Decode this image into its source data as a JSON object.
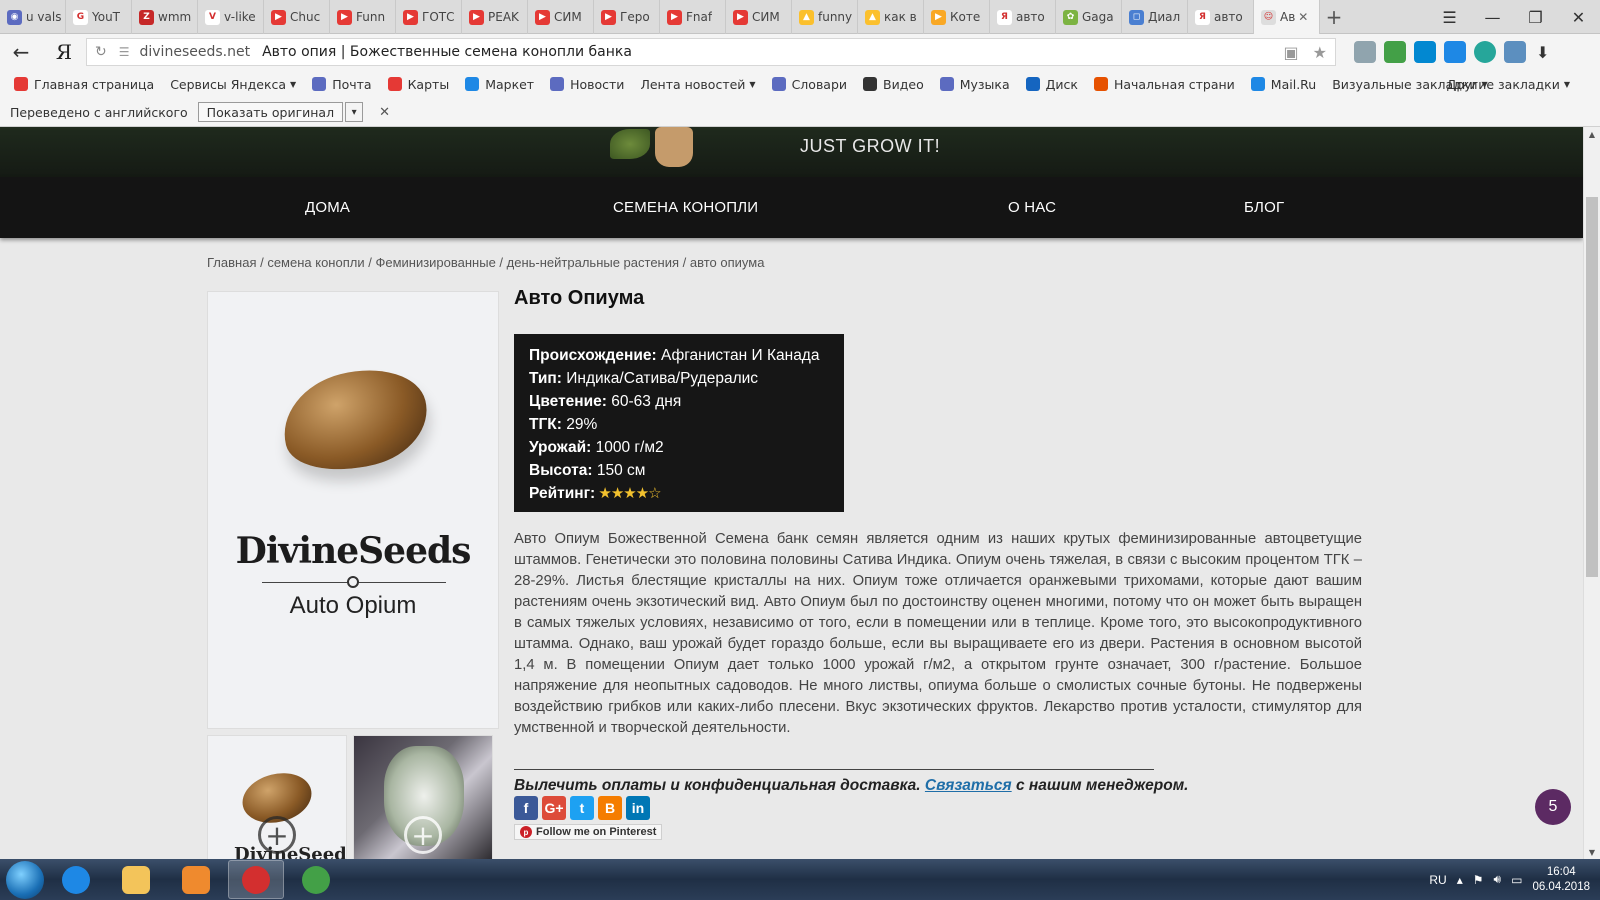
{
  "browser": {
    "tabs": [
      {
        "label": "u vals",
        "color": "#5c6bc0",
        "glyph": "◉"
      },
      {
        "label": "YouT",
        "color": "#ffffff",
        "glyph": "G"
      },
      {
        "label": "wmm",
        "color": "#c62828",
        "glyph": "Z"
      },
      {
        "label": "v-like",
        "color": "#ffffff",
        "glyph": "V"
      },
      {
        "label": "Chuc",
        "color": "#e53935",
        "glyph": "▶"
      },
      {
        "label": "Funn",
        "color": "#e53935",
        "glyph": "▶"
      },
      {
        "label": "ГОТС",
        "color": "#e53935",
        "glyph": "▶"
      },
      {
        "label": "PEAK",
        "color": "#e53935",
        "glyph": "▶"
      },
      {
        "label": "СИМ",
        "color": "#e53935",
        "glyph": "▶"
      },
      {
        "label": "Геро",
        "color": "#e53935",
        "glyph": "▶"
      },
      {
        "label": "Fnaf",
        "color": "#e53935",
        "glyph": "▶"
      },
      {
        "label": "СИМ",
        "color": "#e53935",
        "glyph": "▶"
      },
      {
        "label": "funny",
        "color": "#fbc02d",
        "glyph": "▲"
      },
      {
        "label": "как в",
        "color": "#fbc02d",
        "glyph": "▲"
      },
      {
        "label": "Коте",
        "color": "#f9a825",
        "glyph": "▶"
      },
      {
        "label": "авто",
        "color": "#ffffff",
        "glyph": "Я"
      },
      {
        "label": "Gaga",
        "color": "#7cb342",
        "glyph": "✿"
      },
      {
        "label": "Диал",
        "color": "#4a7fd1",
        "glyph": "◻"
      },
      {
        "label": "авто",
        "color": "#ffffff",
        "glyph": "Я"
      },
      {
        "label": "Ав",
        "color": "#dddddd",
        "glyph": "☺",
        "active": true
      }
    ],
    "new_tab": "+",
    "menu_icon": "☰",
    "minimize": "—",
    "restore": "❐",
    "close": "✕",
    "back": "←",
    "yandex_logo": "Я",
    "reload": "↻",
    "url_domain": "divineseeds.net",
    "url_title": "Авто опия | Божественные семена конопли банка",
    "download_icon": "⬇",
    "bookmarks": [
      {
        "label": "Главная страница",
        "color": "#e53935"
      },
      {
        "label": "Сервисы Яндекса",
        "color": "",
        "caret": true
      },
      {
        "label": "Почта",
        "color": "#5c6bc0"
      },
      {
        "label": "Карты",
        "color": "#e53935"
      },
      {
        "label": "Маркет",
        "color": "#1e88e5"
      },
      {
        "label": "Новости",
        "color": "#5c6bc0"
      },
      {
        "label": "Лента новостей",
        "color": "",
        "caret": true
      },
      {
        "label": "Словари",
        "color": "#5c6bc0"
      },
      {
        "label": "Видео",
        "color": "#333333"
      },
      {
        "label": "Музыка",
        "color": "#5c6bc0"
      },
      {
        "label": "Диск",
        "color": "#1565c0"
      },
      {
        "label": "Начальная страни",
        "color": "#e65100"
      },
      {
        "label": "Mail.Ru",
        "color": "#1e88e5"
      },
      {
        "label": "Визуальные закладки",
        "color": "",
        "caret": true
      }
    ],
    "other_bookmarks": "Другие закладки",
    "translated_from": "Переведено с английского",
    "show_original": "Показать оригинал",
    "close_icon": "✕",
    "caret": "▾"
  },
  "site": {
    "tagline": "JUST GROW IT!",
    "nav": [
      "ДОМА",
      "СЕМЕНА КОНОПЛИ",
      "О НАС",
      "БЛОГ"
    ],
    "breadcrumb": [
      "Главная",
      "семена конопли",
      "Феминизированные",
      "день-нейтральные растения",
      "авто опиума"
    ],
    "image_logo": "DivineSeeds",
    "image_sub": "Auto Opium",
    "plus": "+",
    "product_title": "Авто Опиума",
    "specs": [
      {
        "label": "Происхождение:",
        "value": "Афганистан И Канада"
      },
      {
        "label": "Тип:",
        "value": "Индика/Сатива/Рудералис"
      },
      {
        "label": "Цветение:",
        "value": "60-63 дня"
      },
      {
        "label": "ТГК:",
        "value": "29%"
      },
      {
        "label": "Урожай:",
        "value": "1000 г/м2"
      },
      {
        "label": "Высота:",
        "value": "150 см"
      }
    ],
    "rating_label": "Рейтинг:",
    "rating_stars": 4,
    "rating_max": 5,
    "description": "Авто Опиум Божественной Семена банк семян является одним из наших крутых феминизированные автоцветущие штаммов. Генетически это половина половины Сатива Индика. Опиум очень тяжелая, в связи с высоким процентом ТГК – 28-29%. Листья блестящие кристаллы на них. Опиум тоже отличается оранжевыми трихомами, которые дают вашим растениям очень экзотический вид. Авто Опиум был по достоинству оценен многими, потому что он может быть выращен в самых тяжелых условиях, независимо от того, если в помещении или в теплице. Кроме того, это высокопродуктивного штамма. Однако, ваш урожай будет гораздо больше, если вы выращиваете его из двери. Растения в основном высотой 1,4 м. В помещении Опиум дает только 1000 урожай г/м2, а открытом грунте означает, 300 г/растение. Большое напряжение для неопытных садоводов. Не много листвы, опиума больше о смолистых сочные бутоны. Не подвержены воздействию грибков или каких-либо плесени. Вкус экзотических фруктов. Лекарство против усталости, стимулятор для умственной и творческой деятельности.",
    "delivery_pre": "Вылечить оплаты и конфиденциальная доставка.",
    "delivery_link": "Связаться",
    "delivery_post": "с нашим менеджером.",
    "socials": [
      {
        "glyph": "f",
        "color": "#3b5998"
      },
      {
        "glyph": "G+",
        "color": "#dd4b39"
      },
      {
        "glyph": "t",
        "color": "#1da1f2"
      },
      {
        "glyph": "B",
        "color": "#f57d00"
      },
      {
        "glyph": "in",
        "color": "#0077b5"
      }
    ],
    "pinterest_label": "Follow me on Pinterest",
    "pinterest_glyph": "p",
    "chat_count": "5"
  },
  "taskbar": {
    "lang": "RU",
    "time": "16:04",
    "date": "06.04.2018"
  }
}
